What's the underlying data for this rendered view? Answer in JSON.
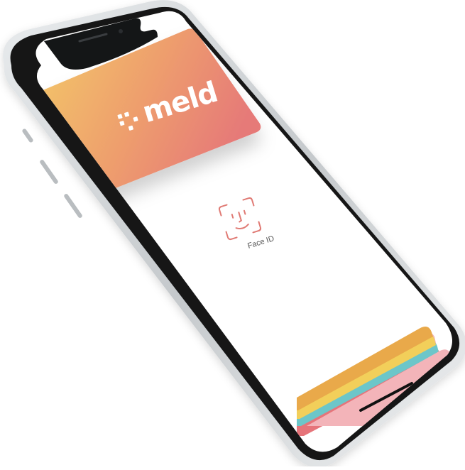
{
  "card": {
    "brand": "meld",
    "gradient_start": "#f2c46b",
    "gradient_end": "#e87d78"
  },
  "face_id": {
    "label": "Face ID",
    "icon": "face-id-icon",
    "icon_color": "#e07a74",
    "label_color": "#555555"
  },
  "wallet_stack": {
    "stripe_colors": [
      "#e9a94a",
      "#f2cf5a",
      "#6cc6c9",
      "#e6747a",
      "#f3b4b9"
    ]
  },
  "device": {
    "frame_color": "#151718",
    "bezel_highlight": "#d8dbdd"
  }
}
